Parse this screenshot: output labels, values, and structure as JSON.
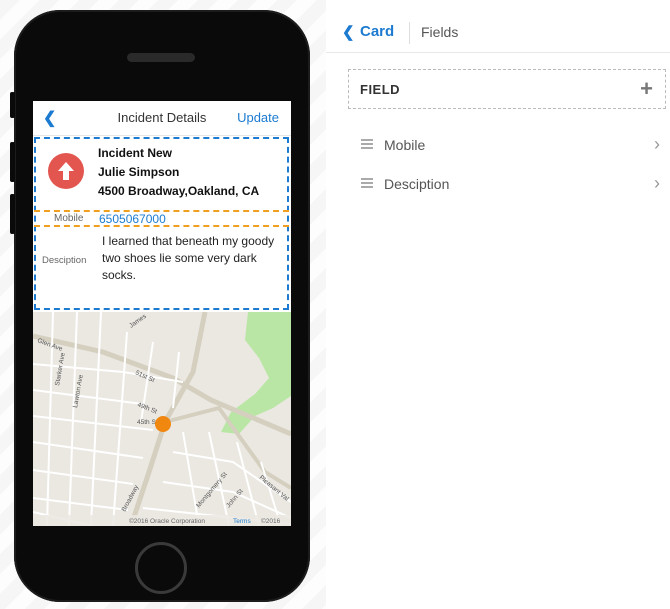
{
  "phone": {
    "nav": {
      "back_icon": "chevron-left-icon",
      "title": "Incident Details",
      "update_label": "Update"
    },
    "card": {
      "alert_icon": "arrow-up-icon",
      "alert_color": "#e35650",
      "line1": "Incident New",
      "line2": "Julie Simpson",
      "line3": "4500 Broadway,Oakland, CA",
      "mobile_label": "Mobile",
      "mobile_value": "6505067000",
      "description_label": "Desciption",
      "description_value": "I learned that beneath my goody two shoes lie some very dark socks."
    },
    "map": {
      "streets": [
        "James",
        "Lawton Ave",
        "Starker Ave",
        "51st St",
        "49th St",
        "45th St",
        "Broadway",
        "Montgomery St",
        "John St",
        "Pleasant Val",
        "Glen Ave"
      ],
      "pin_color": "#f0870f",
      "footer": "©2016 Oracle Corporation",
      "terms": "Terms",
      "year": "©2016"
    }
  },
  "panel": {
    "crumb_back_icon": "chevron-left-icon",
    "crumb_card": "Card",
    "crumb_fields": "Fields",
    "field_header": "FIELD",
    "add_icon": "plus-icon",
    "fields": [
      {
        "name": "Mobile"
      },
      {
        "name": "Desciption"
      }
    ]
  },
  "colors": {
    "accent": "#1c7bd0",
    "card_outline": "#1c7bd0",
    "row_outline": "#f0a020"
  }
}
